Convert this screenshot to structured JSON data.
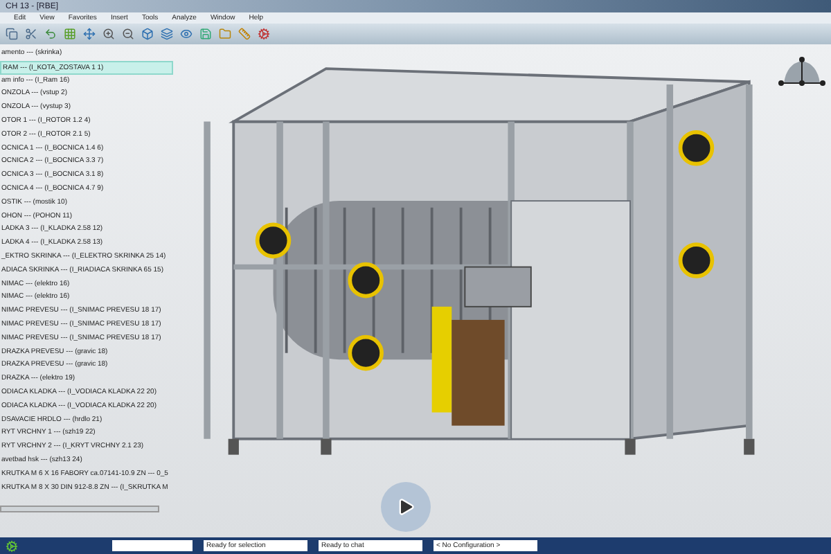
{
  "window": {
    "title": "CH 13 - [RBE]"
  },
  "menu": [
    "Edit",
    "View",
    "Favorites",
    "Insert",
    "Tools",
    "Analyze",
    "Window",
    "Help"
  ],
  "tree": [
    {
      "label": "amento --- (skrinka)",
      "selected": false
    },
    {
      "label": "RAM --- (I_KOTA_ZOSTAVA 1 1)",
      "selected": true
    },
    {
      "label": "am info --- (I_Ram 16)",
      "selected": false
    },
    {
      "label": "ONZOLA --- (vstup 2)",
      "selected": false
    },
    {
      "label": "ONZOLA --- (vystup 3)",
      "selected": false
    },
    {
      "label": "OTOR 1 --- (I_ROTOR 1.2 4)",
      "selected": false
    },
    {
      "label": "OTOR 2 --- (I_ROTOR 2.1 5)",
      "selected": false
    },
    {
      "label": "OCNICA 1 --- (I_BOCNICA 1.4 6)",
      "selected": false
    },
    {
      "label": "OCNICA 2 --- (I_BOCNICA 3.3 7)",
      "selected": false
    },
    {
      "label": "OCNICA 3 --- (I_BOCNICA 3.1 8)",
      "selected": false
    },
    {
      "label": "OCNICA 4 --- (I_BOCNICA 4.7 9)",
      "selected": false
    },
    {
      "label": "OSTIK --- (mostik 10)",
      "selected": false
    },
    {
      "label": "OHON --- (POHON 11)",
      "selected": false
    },
    {
      "label": "LADKA 3 --- (I_KLADKA 2.58 12)",
      "selected": false
    },
    {
      "label": "LADKA 4 --- (I_KLADKA 2.58 13)",
      "selected": false
    },
    {
      "label": "_EKTRO SKRINKA --- (I_ELEKTRO SKRINKA 25 14)",
      "selected": false
    },
    {
      "label": "ADIACA SKRINKA --- (I_RIADIACA SKRINKA 65 15)",
      "selected": false
    },
    {
      "label": "NIMAC --- (elektro 16)",
      "selected": false
    },
    {
      "label": "NIMAC --- (elektro 16)",
      "selected": false
    },
    {
      "label": "NIMAC PREVESU --- (I_SNIMAC PREVESU 18 17)",
      "selected": false
    },
    {
      "label": "NIMAC PREVESU --- (I_SNIMAC PREVESU 18 17)",
      "selected": false
    },
    {
      "label": "NIMAC PREVESU --- (I_SNIMAC PREVESU 18 17)",
      "selected": false
    },
    {
      "label": "DRAZKA PREVESU --- (gravic 18)",
      "selected": false
    },
    {
      "label": "DRAZKA PREVESU --- (gravic 18)",
      "selected": false
    },
    {
      "label": "DRAZKA --- (elektro 19)",
      "selected": false
    },
    {
      "label": "ODIACA KLADKA --- (I_VODIACA KLADKA 22 20)",
      "selected": false
    },
    {
      "label": "ODIACA KLADKA --- (I_VODIACA KLADKA 22 20)",
      "selected": false
    },
    {
      "label": "DSAVACIE HRDLO --- (hrdlo 21)",
      "selected": false
    },
    {
      "label": "RYT VRCHNY 1 --- (szh19 22)",
      "selected": false
    },
    {
      "label": "RYT VRCHNY 2 --- (I_KRYT VRCHNY 2.1 23)",
      "selected": false
    },
    {
      "label": "avetbad hsk --- (szh13 24)",
      "selected": false
    },
    {
      "label": "KRUTKA M 6 X 16 FABORY ca.07141-10.9 ZN --- 0_5",
      "selected": false
    },
    {
      "label": "KRUTKA M 8 X 30 DIN 912-8.8 ZN --- (I_SKRUTKA M",
      "selected": false
    }
  ],
  "status_bar": {
    "fields": [
      "Ready for selection",
      "Ready to chat",
      "< No Configuration >"
    ]
  }
}
